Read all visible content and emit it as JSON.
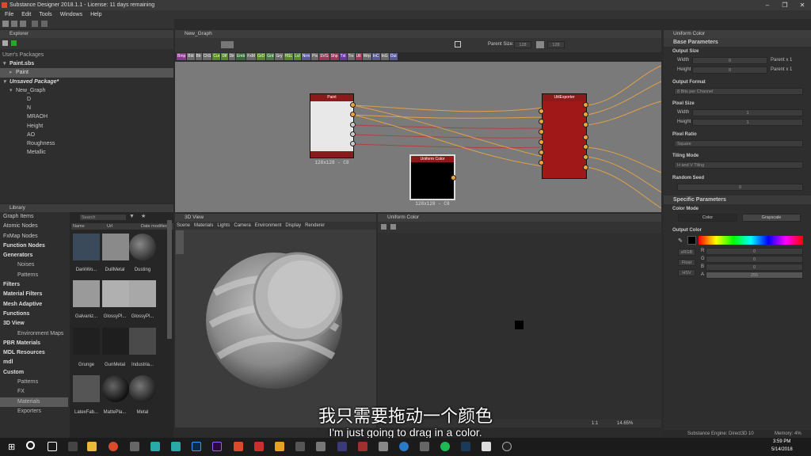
{
  "window": {
    "title": "Substance Designer 2018.1.1 - License: 11 days remaining"
  },
  "menu": [
    "File",
    "Edit",
    "Tools",
    "Windows",
    "Help"
  ],
  "explorer": {
    "title": "Explorer",
    "section": "User's Packages",
    "items": [
      {
        "label": "Paint.sbs",
        "bold": true
      },
      {
        "label": "Paint"
      },
      {
        "label": "Unsaved Package*",
        "bold": true
      },
      {
        "label": "New_Graph"
      },
      {
        "label": "D"
      },
      {
        "label": "N"
      },
      {
        "label": "MRAOH"
      },
      {
        "label": "Height"
      },
      {
        "label": "AO"
      },
      {
        "label": "Roughness"
      },
      {
        "label": "Metallic"
      }
    ]
  },
  "library": {
    "title": "Library",
    "search_placeholder": "Search",
    "columns": [
      "Name",
      "Url",
      "Date modified"
    ],
    "categories": [
      {
        "label": "Graph Items",
        "bold": false
      },
      {
        "label": "Atomic Nodes",
        "bold": false
      },
      {
        "label": "FxMap Nodes",
        "bold": false
      },
      {
        "label": "Function Nodes",
        "bold": true
      },
      {
        "label": "Generators",
        "bold": true
      },
      {
        "label": "Noises",
        "sub": true
      },
      {
        "label": "Patterns",
        "sub": true
      },
      {
        "label": "Filters",
        "bold": true
      },
      {
        "label": "Material Filters",
        "bold": true
      },
      {
        "label": "Mesh Adaptive",
        "bold": true
      },
      {
        "label": "Functions",
        "bold": true
      },
      {
        "label": "3D View",
        "bold": true
      },
      {
        "label": "Environment Maps",
        "sub": true
      },
      {
        "label": "PBR Materials",
        "bold": true
      },
      {
        "label": "MDL Resources",
        "bold": true
      },
      {
        "label": "mdl",
        "bold": true
      },
      {
        "label": "Custom",
        "bold": true
      },
      {
        "label": "Patterns",
        "sub": true
      },
      {
        "label": "FX",
        "sub": true
      },
      {
        "label": "Materials",
        "sub": true,
        "selected": true
      },
      {
        "label": "Exporters",
        "sub": true
      }
    ],
    "thumbnails": [
      {
        "label": "DarkWo...",
        "color": "#3a4a5a"
      },
      {
        "label": "DullMetal",
        "color": "#8a8a8a"
      },
      {
        "label": "Dusting",
        "color": "#6a6a6a"
      },
      {
        "label": "Galvaniz...",
        "color": "#9a9a9a"
      },
      {
        "label": "GlossyPl...",
        "color": "#b0b0b0"
      },
      {
        "label": "GlossyPl...",
        "color": "#a8a8a8"
      },
      {
        "label": "Grunge",
        "color": "#202020"
      },
      {
        "label": "GunMetal",
        "color": "#1e1e1e"
      },
      {
        "label": "Industria...",
        "color": "#4a4a4a"
      },
      {
        "label": "LatexFab...",
        "color": "#555"
      },
      {
        "label": "MattePla...",
        "color": "#2a2a2a"
      },
      {
        "label": "Metal",
        "color": "#3a3a3a"
      }
    ]
  },
  "graph": {
    "title": "New_Graph",
    "parent_size_label": "Parent Size:",
    "parent_size_value": "128",
    "size_value": "128",
    "node_buttons": [
      {
        "label": "Bmp",
        "color": "#8b3a8b"
      },
      {
        "label": "Bld",
        "color": "#6b6b6b"
      },
      {
        "label": "Blr",
        "color": "#6b6b6b"
      },
      {
        "label": "ChS",
        "color": "#6b6b6b"
      },
      {
        "label": "Cur",
        "color": "#5a8a2a"
      },
      {
        "label": "Dif",
        "color": "#5a8a2a"
      },
      {
        "label": "Dir",
        "color": "#6b6b6b"
      },
      {
        "label": "Emb",
        "color": "#3a6a3a"
      },
      {
        "label": "FxM",
        "color": "#6b6b6b"
      },
      {
        "label": "GrD",
        "color": "#5a8a2a"
      },
      {
        "label": "Grd",
        "color": "#4a7a4a"
      },
      {
        "label": "Gry",
        "color": "#6b6b6b"
      },
      {
        "label": "HSL",
        "color": "#5a8a2a"
      },
      {
        "label": "Lvl",
        "color": "#5a8a2a"
      },
      {
        "label": "Nrm",
        "color": "#5a5a9a"
      },
      {
        "label": "Pix",
        "color": "#6b6b6b"
      },
      {
        "label": "SVG",
        "color": "#9a3a5a"
      },
      {
        "label": "Shp",
        "color": "#9a3a5a"
      },
      {
        "label": "Txt",
        "color": "#6b3a9a"
      },
      {
        "label": "Trs",
        "color": "#6b6b6b"
      },
      {
        "label": "Ult",
        "color": "#9a3a5a"
      },
      {
        "label": "Wrp",
        "color": "#6b6b6b"
      },
      {
        "label": "InC",
        "color": "#5a5a9a"
      },
      {
        "label": "InG",
        "color": "#6b6b6b"
      },
      {
        "label": "Out",
        "color": "#5a5a9a"
      }
    ],
    "nodes": {
      "paint": {
        "title": "Paint",
        "size": "128x128 - C8"
      },
      "uniform": {
        "title": "Uniform Color",
        "size": "128x128 - C8"
      },
      "exporter": {
        "title": "UtilExporter"
      }
    }
  },
  "view3d": {
    "title": "3D View",
    "menu": [
      "Scene",
      "Materials",
      "Lights",
      "Camera",
      "Environment",
      "Display",
      "Renderer"
    ]
  },
  "view2d": {
    "title": "Uniform Color",
    "ratio": "1:1",
    "zoom": "14.65%"
  },
  "props": {
    "title": "Uniform Color",
    "base_parameters": "Base Parameters",
    "output_size": "Output Size",
    "width_label": "Width",
    "height_label": "Height",
    "width_value": "0",
    "height_value": "0",
    "relative_label": "Parent x 1",
    "output_format": "Output Format",
    "output_format_value": "8 Bits per Channel",
    "pixel_size": "Pixel Size",
    "pixel_width": "1",
    "pixel_height": "1",
    "pixel_ratio": "Pixel Ratio",
    "pixel_ratio_value": "Square",
    "tiling_mode": "Tiling Mode",
    "tiling_mode_value": "H and V Tiling",
    "random_seed": "Random Seed",
    "random_seed_value": "0",
    "specific_parameters": "Specific Parameters",
    "color_mode": "Color Mode",
    "color_button": "Color",
    "grayscale_button": "Grayscale",
    "output_color": "Output Color",
    "srgb": "sRGB",
    "float": "Float",
    "hsv": "HSV",
    "r": "R",
    "g": "G",
    "b": "B",
    "a": "A",
    "r_value": "0",
    "g_value": "0",
    "b_value": "0",
    "a_value": "255"
  },
  "status": {
    "engine": "Substance Engine: Direct3D 10",
    "memory": "Memory: 4%"
  },
  "taskbar": {
    "time": "3:59 PM",
    "date": "5/14/2018"
  },
  "subtitles": {
    "cn": "我只需要拖动一个颜色",
    "en": "I'm just going to drag in a color."
  }
}
